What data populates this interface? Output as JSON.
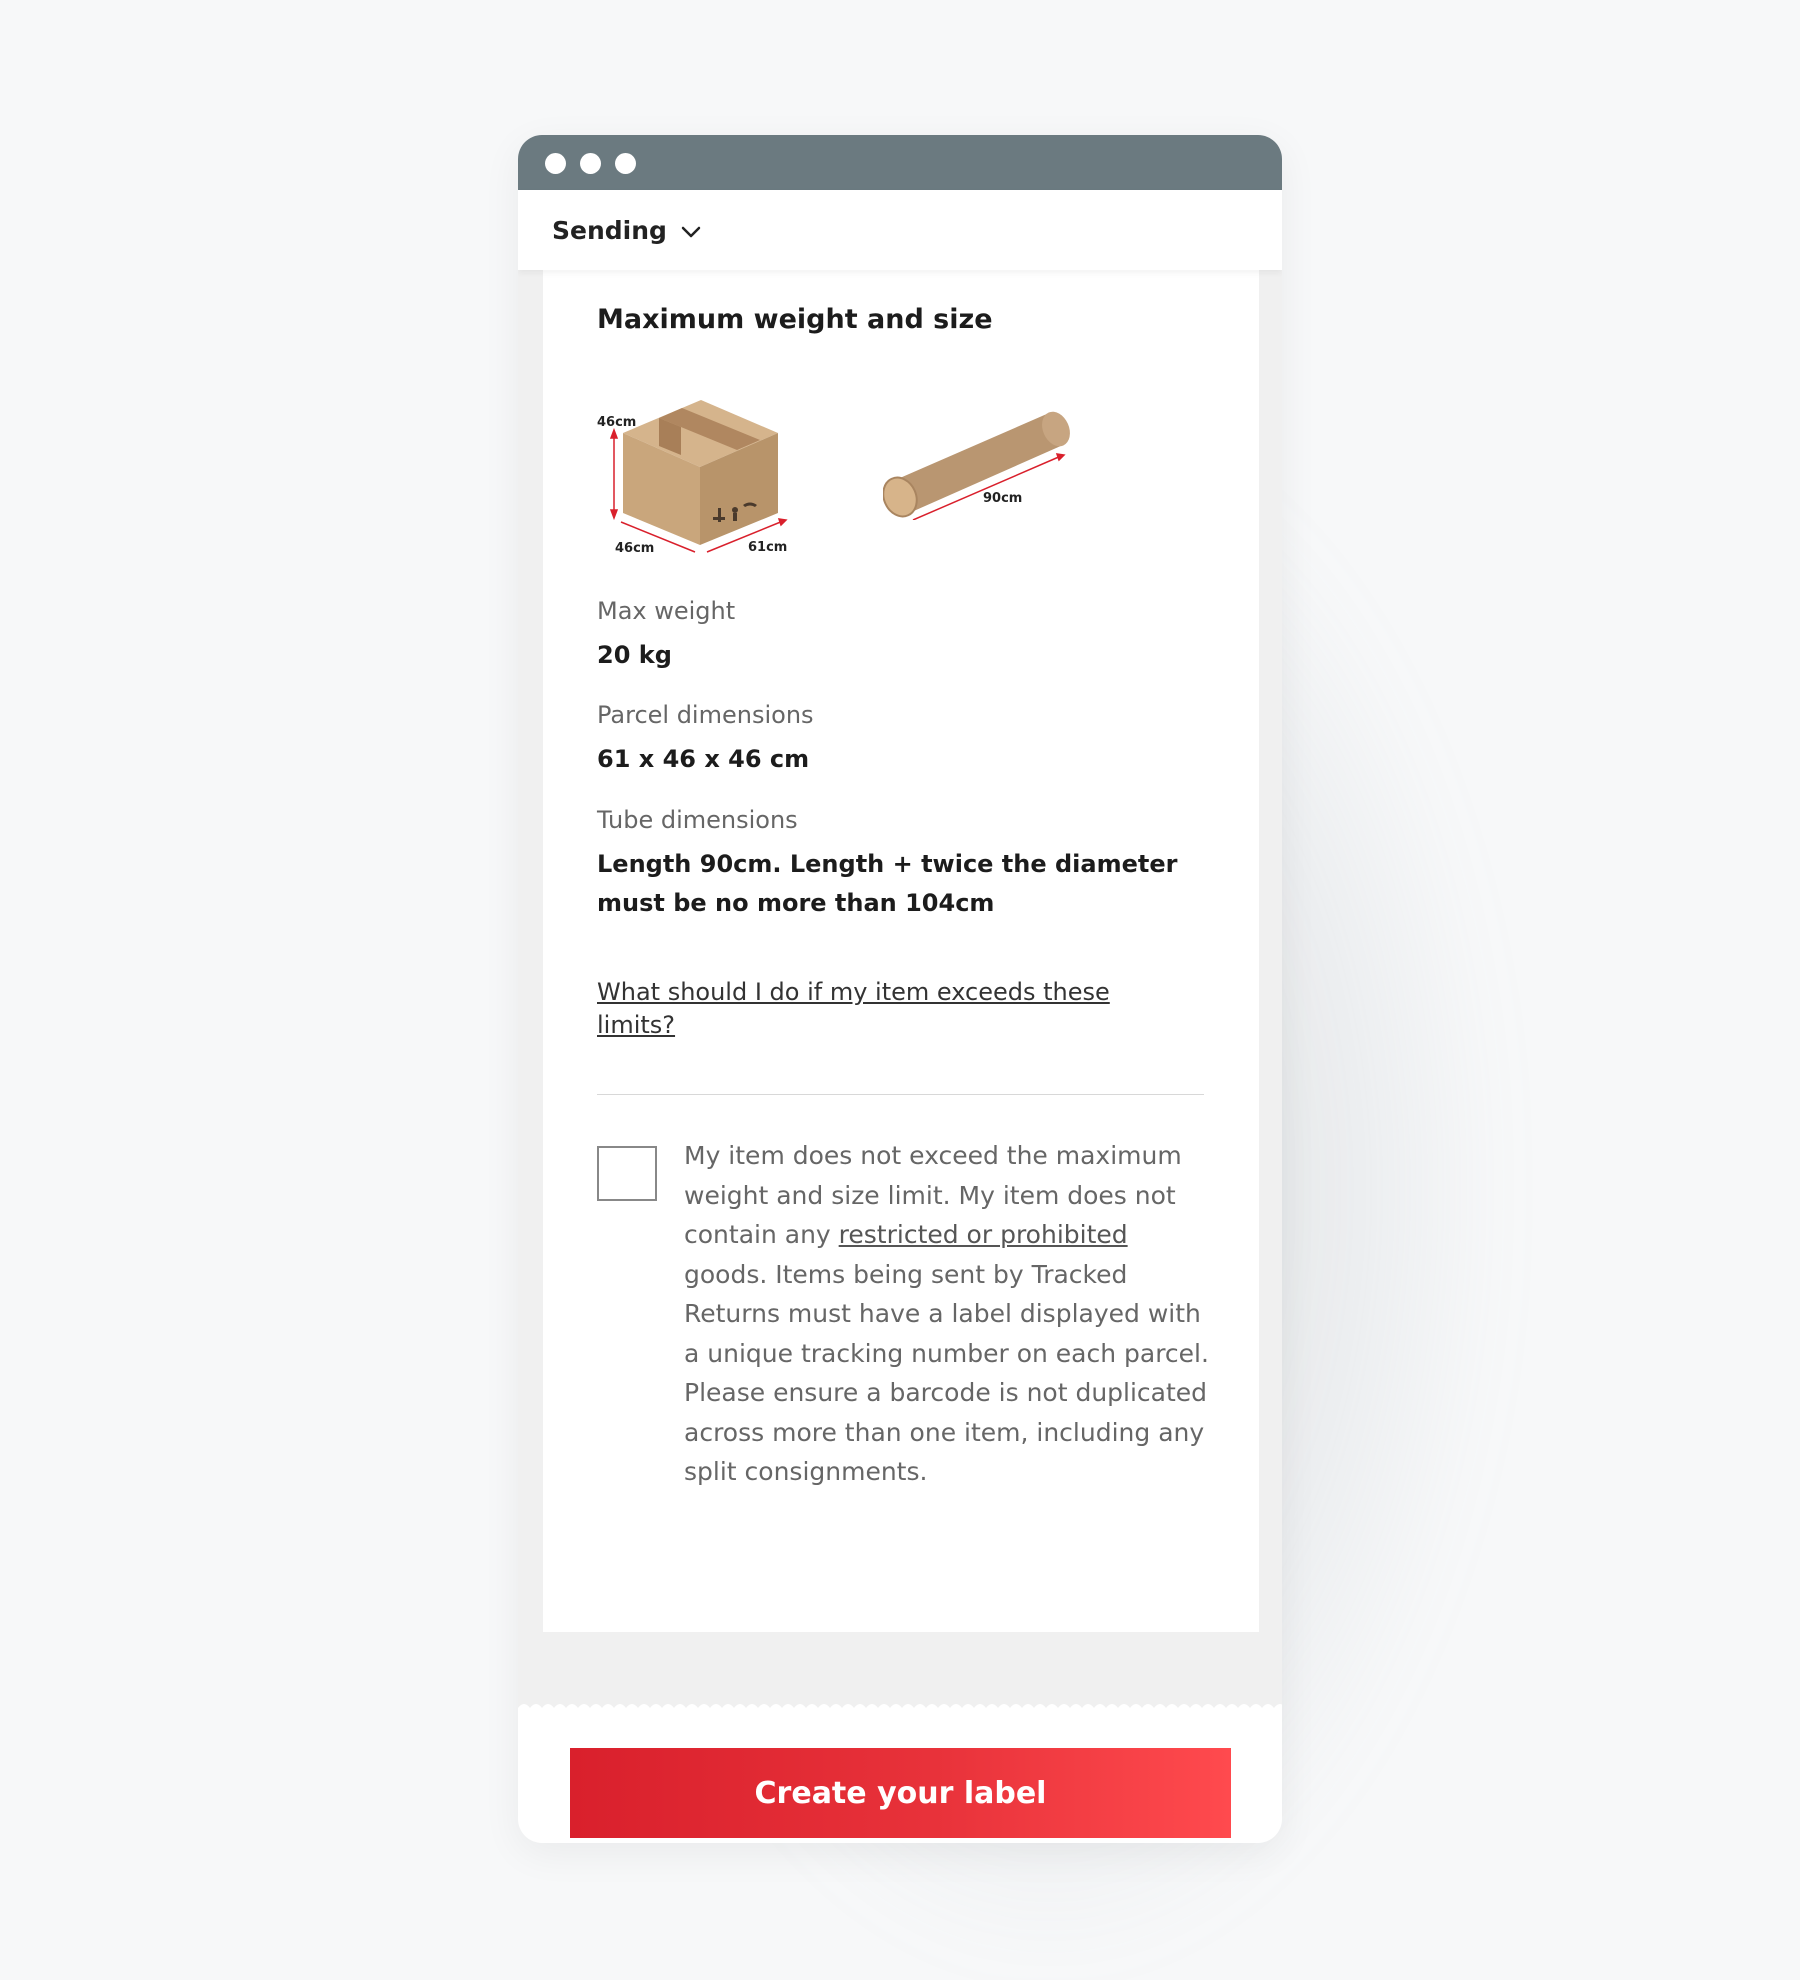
{
  "window": {
    "controls": [
      "dot",
      "dot",
      "dot"
    ]
  },
  "nav": {
    "label": "Sending"
  },
  "card": {
    "title": "Maximum weight and size",
    "box_illustration": {
      "height_label": "46cm",
      "depth_label": "46cm",
      "width_label": "61cm"
    },
    "tube_illustration": {
      "length_label": "90cm"
    },
    "max_weight": {
      "label": "Max weight",
      "value": "20 kg"
    },
    "parcel_dimensions": {
      "label": "Parcel dimensions",
      "value": "61 x 46 x 46 cm"
    },
    "tube_dimensions": {
      "label": "Tube dimensions",
      "value": "Length 90cm. Length + twice the diameter must be no more than 104cm"
    },
    "limits_link": "What should I do if my item exceeds these limits?",
    "consent": {
      "checked": false,
      "text_before": "My item does not exceed the maximum weight and size limit. My item does not contain any ",
      "link_text": "restricted or prohibited",
      "text_after": " goods. Items being sent by Tracked Returns must have a label displayed with a unique tracking number on each parcel. Please ensure a barcode is not duplicated across more than one item, including any split consignments."
    }
  },
  "cta": {
    "label": "Create your label"
  },
  "colors": {
    "titlebar": "#6b7a80",
    "cta_start": "#d9202c",
    "cta_end": "#ff4a4e",
    "page_bg": "#f7f8f9"
  }
}
